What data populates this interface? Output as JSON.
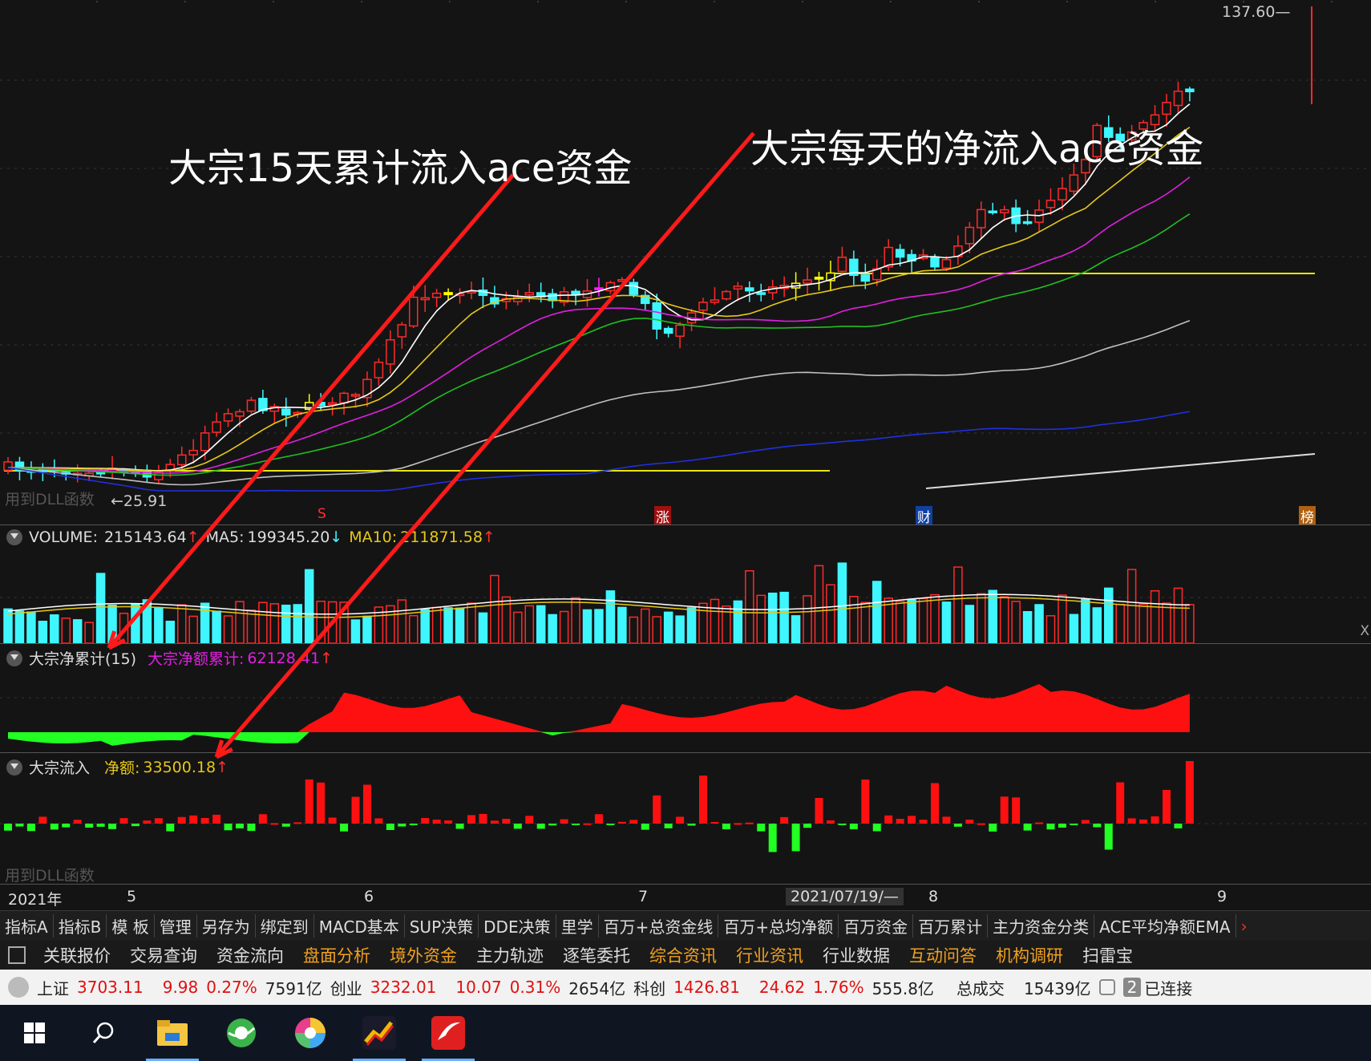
{
  "chart": {
    "price_high_label": "137.60",
    "price_low_label": "25.91",
    "dll_label": "用到DLL函数",
    "markers": [
      "S",
      "涨",
      "财",
      "榜"
    ],
    "colors": {
      "up": "#ff2a2a",
      "down": "#3ff6ff",
      "special_yellow": "#ffff00",
      "special_magenta": "#ff22ff",
      "ma5": "#ffffff",
      "ma10": "#e6c818",
      "ma20": "#e020e0",
      "ma30": "#20c020",
      "ma60": "#c0c0c0",
      "ma120": "#2030e0",
      "support": "#e6e600"
    }
  },
  "annotations": {
    "left": "大宗15天累计流入ace资金",
    "right": "大宗每天的净流入ace资金"
  },
  "volume": {
    "title": "VOLUME:",
    "value": "215143.64",
    "ma5_label": "MA5:",
    "ma5_value": "199345.20",
    "ma10_label": "MA10:",
    "ma10_value": "211871.58"
  },
  "cum": {
    "title": "大宗净累计(15)",
    "series_label": "大宗净额累计:",
    "series_value": "62128.41"
  },
  "flow": {
    "title": "大宗流入",
    "series_label": "净额:",
    "series_value": "33500.18",
    "dll_label": "用到DLL函数"
  },
  "time_axis": {
    "year": "2021年",
    "m5": "5",
    "m6": "6",
    "m7": "7",
    "cursor_date": "2021/07/19/—",
    "m8": "8",
    "m9": "9"
  },
  "tabs": [
    "指标A",
    "指标B",
    "模 板",
    "管理",
    "另存为",
    "绑定到",
    "MACD基本",
    "SUP决策",
    "DDE决策",
    "里学",
    "百万+总资金线",
    "百万+总均净额",
    "百万资金",
    "百万累计",
    "主力资金分类",
    "ACE平均净额EMA"
  ],
  "funcbar": [
    {
      "label": "关联报价",
      "color": "#dddddd"
    },
    {
      "label": "交易查询",
      "color": "#dddddd"
    },
    {
      "label": "资金流向",
      "color": "#dddddd"
    },
    {
      "label": "盘面分析",
      "color": "#f0a020"
    },
    {
      "label": "境外资金",
      "color": "#f0a020"
    },
    {
      "label": "主力轨迹",
      "color": "#dddddd"
    },
    {
      "label": "逐笔委托",
      "color": "#dddddd"
    },
    {
      "label": "综合资讯",
      "color": "#f0a020"
    },
    {
      "label": "行业资讯",
      "color": "#f0a020"
    },
    {
      "label": "行业数据",
      "color": "#dddddd"
    },
    {
      "label": "互动问答",
      "color": "#f0a020"
    },
    {
      "label": "机构调研",
      "color": "#f0a020"
    },
    {
      "label": "扫雷宝",
      "color": "#dddddd"
    }
  ],
  "status": {
    "sh_label": "上证",
    "sh_value": "3703.11",
    "sh_change": "9.98",
    "sh_pct": "0.27%",
    "sh_amount": "7591亿",
    "cy_label": "创业",
    "cy_value": "3232.01",
    "cy_change": "10.07",
    "cy_pct": "0.31%",
    "cy_amount": "2654亿",
    "kc_label": "科创",
    "kc_value": "1426.81",
    "kc_change": "24.62",
    "kc_pct": "1.76%",
    "kc_amount": "555.8亿",
    "total_label": "总成交",
    "total_value": "15439亿",
    "badge": "2",
    "connected": "已连接"
  },
  "taskbar_icons": [
    "windows-start-icon",
    "search-icon",
    "file-explorer-icon",
    "browser-icon",
    "color-wheel-icon",
    "stock-app-icon",
    "flash-app-icon"
  ]
}
